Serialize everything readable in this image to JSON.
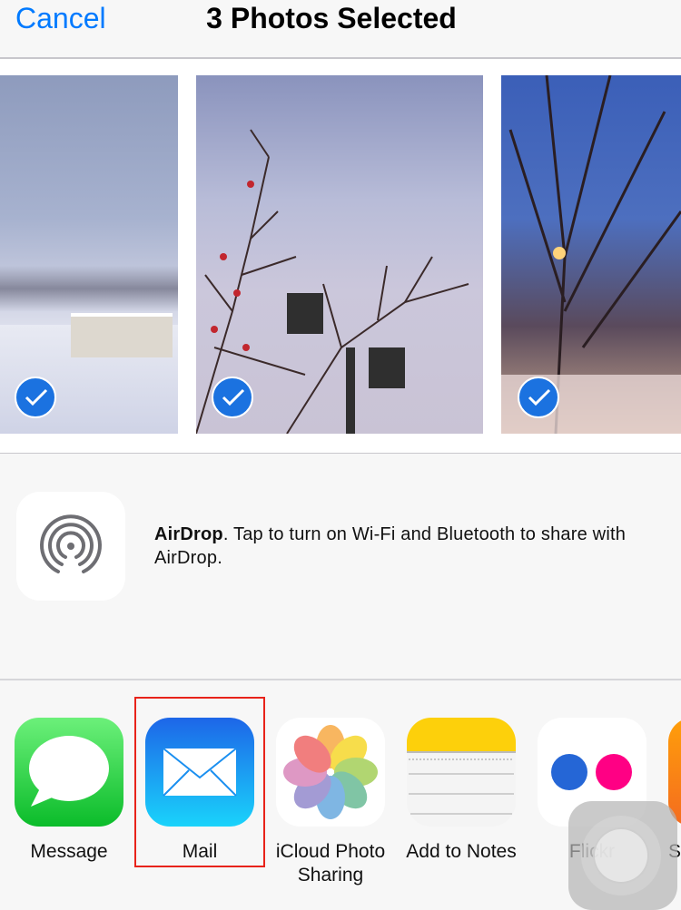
{
  "header": {
    "cancel_label": "Cancel",
    "title": "3 Photos Selected"
  },
  "photos": [
    {
      "name": "snowy-barn-photo",
      "selected": true
    },
    {
      "name": "streetlamp-tree-photo",
      "selected": true
    },
    {
      "name": "night-street-photo",
      "selected": true
    }
  ],
  "airdrop": {
    "icon": "airdrop-icon",
    "title": "AirDrop",
    "message": ". Tap to turn on Wi-Fi and Bluetooth to share with AirDrop."
  },
  "apps": [
    {
      "label": "Message",
      "icon": "message-icon"
    },
    {
      "label": "Mail",
      "icon": "mail-icon",
      "highlighted": true
    },
    {
      "label": "iCloud Photo Sharing",
      "icon": "photos-icon"
    },
    {
      "label": "Add to Notes",
      "icon": "notes-icon"
    },
    {
      "label": "Flickr",
      "icon": "flickr-icon"
    },
    {
      "label": "Sa",
      "icon": "partial-app-icon"
    }
  ],
  "colors": {
    "accent": "#007aff",
    "check": "#1b72e0",
    "highlight": "#e8231a",
    "flickr_blue": "#2566d6",
    "flickr_pink": "#ff0084"
  }
}
